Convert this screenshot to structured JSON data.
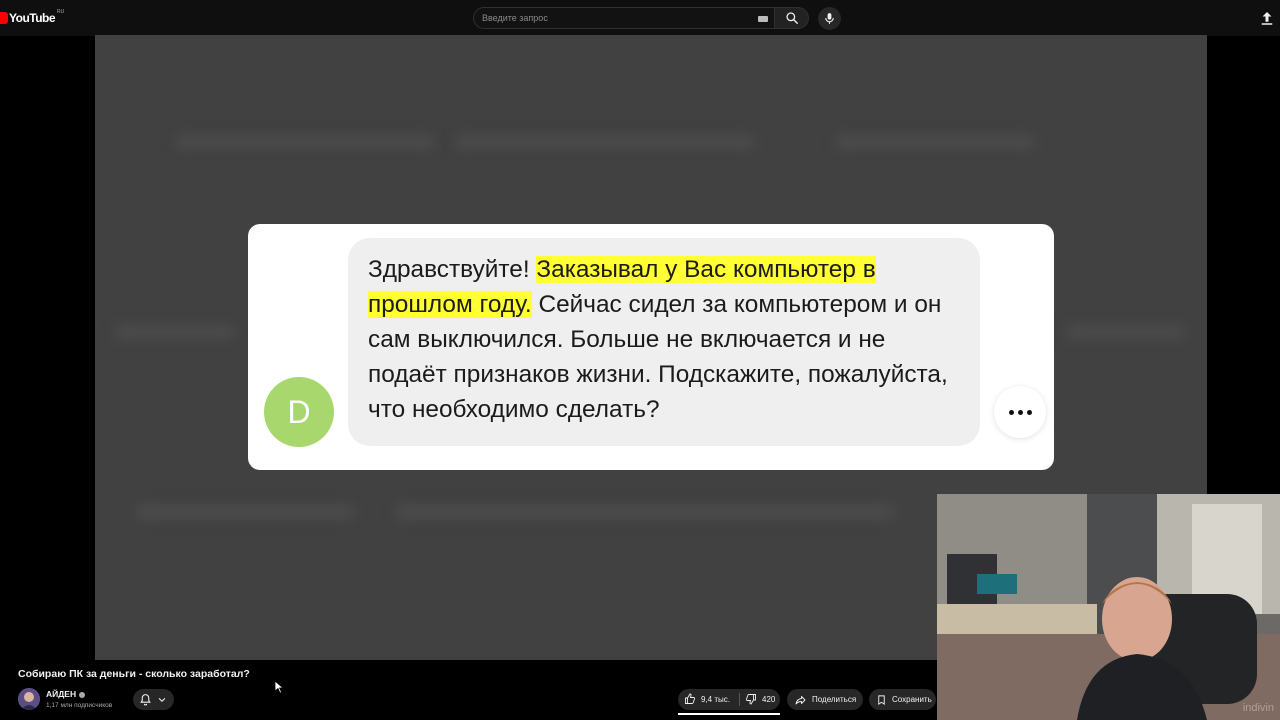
{
  "header": {
    "logo_text": "YouTube",
    "logo_region": "RU",
    "search_placeholder": "Введите запрос",
    "icons": [
      "keyboard-icon",
      "search-icon",
      "mic-icon",
      "upload-icon"
    ]
  },
  "video": {
    "chat": {
      "avatar_letter": "D",
      "message_before": "Здравствуйте! ",
      "message_highlight": "Заказывал у Вас компьютер в прошлом году.",
      "message_after": " Сейчас сидел за компьютером и он сам выключился. Больше не включается и не подаёт признаков жизни. Подскажите, пожалуйста, что необходимо сделать?",
      "highlight_color": "#ffff33",
      "avatar_color": "#a8d86d"
    }
  },
  "webcam": {
    "watermark": "indivin"
  },
  "info": {
    "title": "Собираю ПК за деньги - сколько заработал?",
    "channel_name": "АЙДЕН",
    "subscribers": "1,17 млн подписчиков",
    "likes": "9,4 тыс.",
    "dislikes": "420",
    "share_label": "Поделиться",
    "save_label": "Сохранить"
  }
}
